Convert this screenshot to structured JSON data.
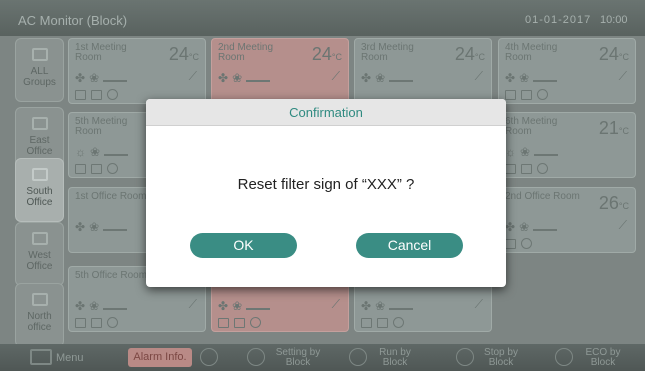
{
  "titlebar": {
    "title": "AC Monitor (Block)",
    "date": "01-01-2017",
    "time": "10:00"
  },
  "groups": [
    {
      "label": "ALL Groups",
      "active": false
    },
    {
      "label": "East Office",
      "active": false
    },
    {
      "label": "South Office",
      "active": true
    },
    {
      "label": "West Office",
      "active": false
    },
    {
      "label": "North office",
      "active": false
    }
  ],
  "rooms": [
    {
      "name": "1st Meeting Room",
      "temp": "24",
      "unit": "°C",
      "alarm": false
    },
    {
      "name": "2nd Meeting Room",
      "temp": "24",
      "unit": "°C",
      "alarm": true
    },
    {
      "name": "3rd Meeting Room",
      "temp": "24",
      "unit": "°C",
      "alarm": false
    },
    {
      "name": "4th Meeting Room",
      "temp": "24",
      "unit": "°C",
      "alarm": false
    },
    {
      "name": "5th Meeting Room",
      "temp": "",
      "unit": "",
      "alarm": false
    },
    {
      "name": "",
      "temp": "",
      "unit": "",
      "alarm": true
    },
    {
      "name": "",
      "temp": "",
      "unit": "",
      "alarm": false
    },
    {
      "name": "6th Meeting Room",
      "temp": "21",
      "unit": "°C",
      "alarm": false
    },
    {
      "name": "1st Office Room",
      "temp": "",
      "unit": "",
      "alarm": false
    },
    {
      "name": "",
      "temp": "",
      "unit": "",
      "alarm": true
    },
    {
      "name": "",
      "temp": "",
      "unit": "",
      "alarm": false
    },
    {
      "name": "2nd Office Room",
      "temp": "26",
      "unit": "°C",
      "alarm": false
    },
    {
      "name": "5th Office Room",
      "temp": "",
      "unit": "",
      "alarm": false
    },
    {
      "name": "",
      "temp": "",
      "unit": "",
      "alarm": true
    },
    {
      "name": "",
      "temp": "",
      "unit": "",
      "alarm": false
    }
  ],
  "bottombar": {
    "menu": "Menu",
    "alarm": "Alarm Info.",
    "setting": "Setting by Block",
    "run": "Run by Block",
    "stop": "Stop by Block",
    "eco": "ECO by Block"
  },
  "dialog": {
    "title": "Confirmation",
    "message": "Reset filter sign of “XXX” ?",
    "ok": "OK",
    "cancel": "Cancel"
  },
  "colors": {
    "accent": "#3a8d84",
    "alarm": "#b58f8c"
  }
}
